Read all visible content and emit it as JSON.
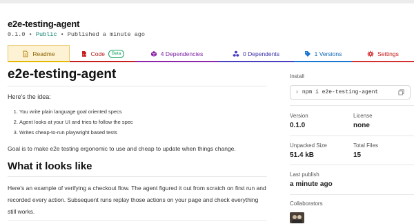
{
  "package": {
    "name": "e2e-testing-agent",
    "version": "0.1.0",
    "sep1": "•",
    "visibility": "Public",
    "sep2": "•",
    "published": "Published a minute ago"
  },
  "tabs": [
    {
      "label": "Readme",
      "icon": "file-text-icon",
      "color": "#8a6100"
    },
    {
      "label": "Code",
      "badge": "Beta",
      "icon": "code-file-icon",
      "color": "#b31b1b"
    },
    {
      "label": "4 Dependencies",
      "icon": "cube-icon",
      "color": "#7a1fa2"
    },
    {
      "label": "0 Dependents",
      "icon": "cubes-icon",
      "color": "#3a2fa8"
    },
    {
      "label": "1 Versions",
      "icon": "tag-icon",
      "color": "#0d66b8"
    },
    {
      "label": "Settings",
      "icon": "gear-icon",
      "color": "#c21616"
    }
  ],
  "readme": {
    "title": "e2e-testing-agent",
    "intro": "Here's the idea:",
    "steps": [
      "You write plain language goal oriented specs",
      "Agent looks at your UI and tries to follow the spec",
      "Writes cheap-to-run playwright based tests"
    ],
    "goal": "Goal is to make e2e testing ergonomic to use and cheap to update when things change.",
    "section_title": "What it looks like",
    "example": "Here's an example of verifying a checkout flow. The agent figured it out from scratch on first run and recorded every action. Subsequent runs replay those actions on your page and check everything still works."
  },
  "sidebar": {
    "install_label": "Install",
    "install_command": "npm i e2e-testing-agent",
    "version_label": "Version",
    "version_value": "0.1.0",
    "license_label": "License",
    "license_value": "none",
    "unpacked_label": "Unpacked Size",
    "unpacked_value": "51.4 kB",
    "files_label": "Total Files",
    "files_value": "15",
    "last_publish_label": "Last publish",
    "last_publish_value": "a minute ago",
    "collaborators_label": "Collaborators"
  }
}
